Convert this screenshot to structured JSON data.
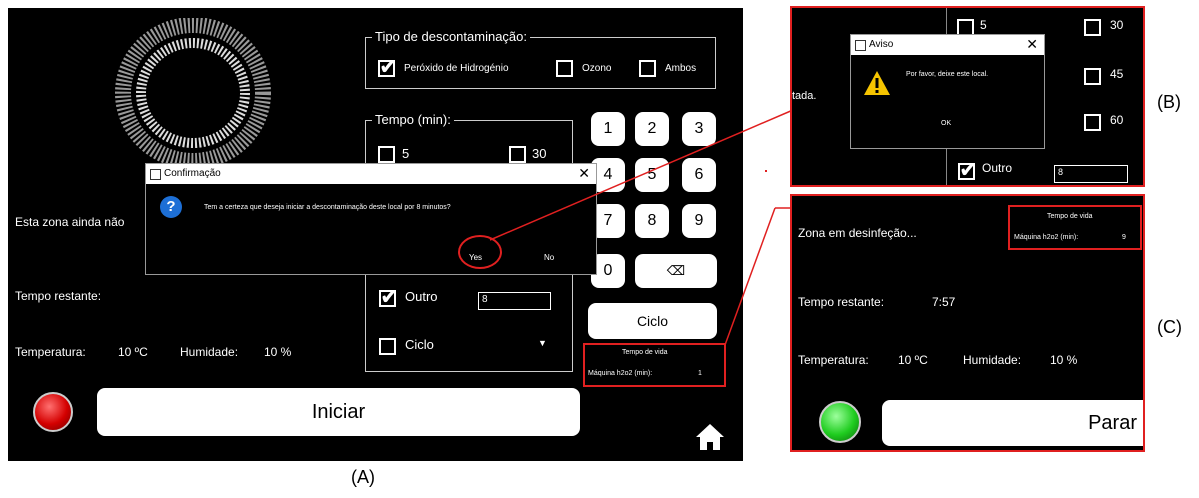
{
  "panel_a": {
    "tipo": {
      "legend": "Tipo de descontaminação:",
      "options": [
        "Peróxido de Hidrogénio",
        "Ozono",
        "Ambos"
      ]
    },
    "tempo": {
      "legend": "Tempo (min):",
      "opt_5": "5",
      "opt_30": "30",
      "outro": "Outro",
      "outro_value": "8",
      "ciclo": "Ciclo"
    },
    "keypad": [
      "1",
      "2",
      "3",
      "4",
      "5",
      "6",
      "7",
      "8",
      "9",
      "0"
    ],
    "backspace_symbol": "⌫",
    "ciclo_button": "Ciclo",
    "status_text": "Esta zona ainda não",
    "tempo_restante_label": "Tempo restante:",
    "temperatura_label": "Temperatura:",
    "temperatura_value": "10 ºC",
    "humidade_label": "Humidade:",
    "humidade_value": "10 %",
    "vida": {
      "title": "Tempo de vida",
      "label": "Máquina h2o2 (min):",
      "value": "1"
    },
    "iniciar": "Iniciar",
    "confirm_dialog": {
      "title": "Confirmação",
      "message": "Tem a certeza que deseja iniciar a descontaminação deste local por 8 minutos?",
      "yes": "Yes",
      "no": "No"
    },
    "caption": "(A)"
  },
  "panel_b": {
    "title": "Aviso",
    "message": "Por favor, deixe este local.",
    "ok": "OK",
    "left_text": "tada.",
    "opt_5": "5",
    "opt_30": "30",
    "opt_45": "45",
    "opt_60": "60",
    "outro": "Outro",
    "outro_value": "8",
    "caption": "(B)"
  },
  "panel_c": {
    "status_text": "Zona em desinfeção...",
    "vida": {
      "title": "Tempo de vida",
      "label": "Máquina h2o2 (min):",
      "value": "9"
    },
    "tempo_restante_label": "Tempo restante:",
    "tempo_restante_value": "7:57",
    "temperatura_label": "Temperatura:",
    "temperatura_value": "10 ºC",
    "humidade_label": "Humidade:",
    "humidade_value": "10 %",
    "parar": "Parar",
    "caption": "(C)"
  },
  "colors": {
    "accent_red": "#e02020",
    "led_red": "#d40000",
    "led_green": "#1fcc1f",
    "info_blue": "#1d6fd6",
    "warning_yellow": "#f5c400"
  }
}
